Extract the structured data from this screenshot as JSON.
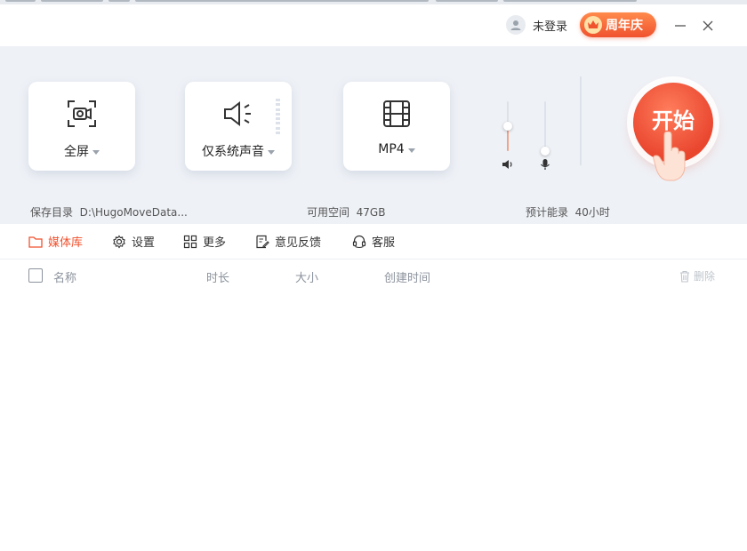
{
  "titlebar": {
    "user_label": "未登录",
    "anniversary_label": "周年庆"
  },
  "sources": [
    {
      "label": "全屏",
      "icon": "screen-capture-icon"
    },
    {
      "label": "仅系统声音",
      "icon": "speaker-icon"
    },
    {
      "label": "MP4",
      "icon": "film-icon"
    }
  ],
  "volume": {
    "system_level": 0.5,
    "mic_level": 0.0
  },
  "start_label": "开始",
  "info": {
    "save_dir_label": "保存目录",
    "save_dir_value": "D:\\HugoMoveData...",
    "free_space_label": "可用空间",
    "free_space_value": "47GB",
    "estimate_label": "预计能录",
    "estimate_value": "40小时"
  },
  "tabs": [
    {
      "label": "媒体库",
      "icon": "folder-icon",
      "active": true
    },
    {
      "label": "设置",
      "icon": "gear-icon"
    },
    {
      "label": "更多",
      "icon": "grid-icon"
    },
    {
      "label": "意见反馈",
      "icon": "feedback-icon"
    },
    {
      "label": "客服",
      "icon": "headset-icon"
    }
  ],
  "columns": [
    "名称",
    "时长",
    "大小",
    "创建时间"
  ],
  "delete_label": "删除",
  "colors": {
    "accent": "#f0522e",
    "panel_bg": "#eef1f6"
  }
}
